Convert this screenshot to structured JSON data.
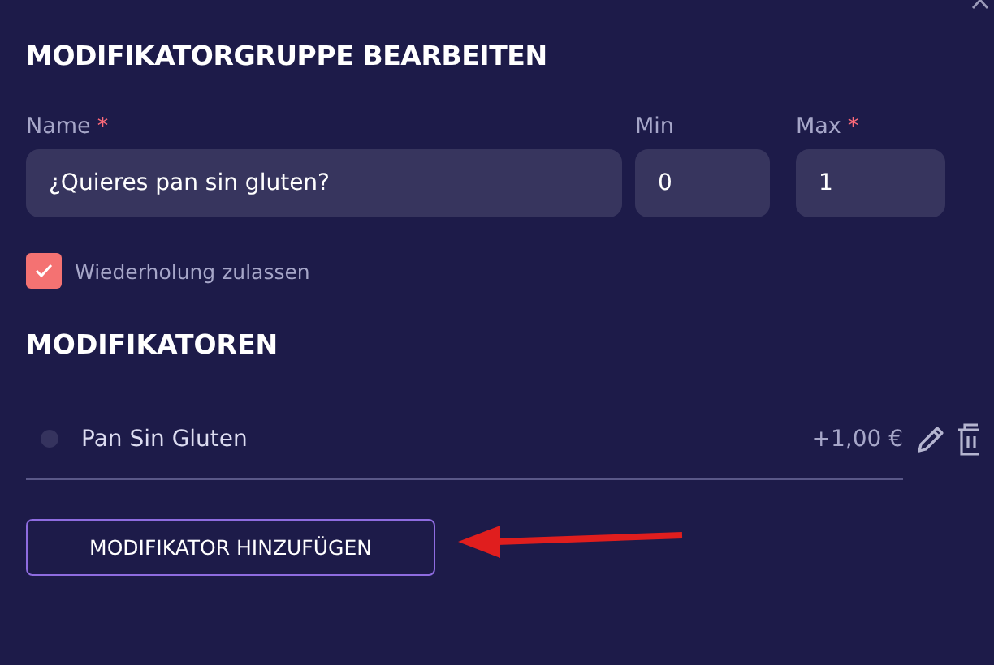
{
  "dialog": {
    "title": "MODIFIKATORGRUPPE BEARBEITEN"
  },
  "fields": [
    {
      "label": "Name",
      "required_mark": "*",
      "value": "¿Quieres pan sin gluten?",
      "kind": "wide"
    },
    {
      "label": "Min",
      "value": "0",
      "kind": "narrow"
    },
    {
      "label": "Max",
      "required_mark": "*",
      "value": "1",
      "kind": "narrow"
    }
  ],
  "repeat_option": {
    "label": "Wiederholung zulassen",
    "checked": true
  },
  "modifiers_section": {
    "title": "MODIFIKATOREN"
  },
  "modifiers": [
    {
      "name": "Pan Sin Gluten",
      "price": "+1,00 €"
    }
  ],
  "add_button": {
    "label": "MODIFIKATOR HINZUFÜGEN"
  }
}
